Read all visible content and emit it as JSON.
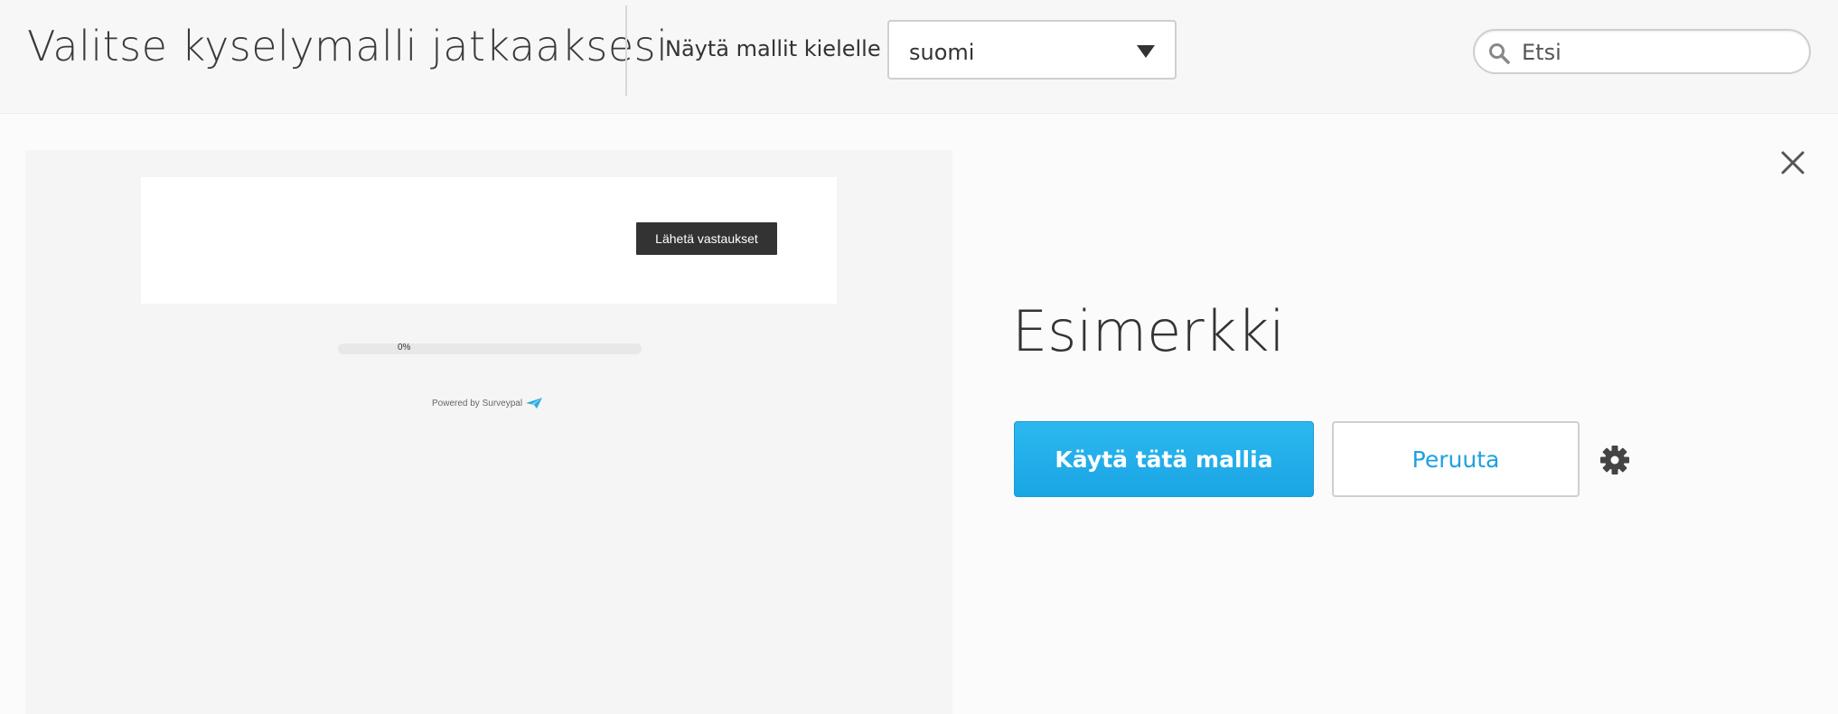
{
  "header": {
    "title": "Valitse kyselymalli jatkaaksesi",
    "language_label": "Näytä mallit kielelle",
    "language_selected": "suomi",
    "search_placeholder": "Etsi"
  },
  "preview": {
    "submit_label": "Lähetä vastaukset",
    "progress_text": "0%",
    "progress_value": 0,
    "powered_by": "Powered by Surveypal"
  },
  "details": {
    "template_name": "Esimerkki",
    "use_button_label": "Käytä tätä mallia",
    "cancel_button_label": "Peruuta"
  },
  "colors": {
    "accent": "#1ba2de",
    "primary_button": "#22afe9",
    "header_bg": "#f7f7f7",
    "preview_bg": "#f5f5f5"
  },
  "icons": {
    "search": "search-icon",
    "close": "close-icon",
    "settings": "gear-icon",
    "dropdown": "caret-down-icon",
    "brand": "paper-plane-icon"
  }
}
